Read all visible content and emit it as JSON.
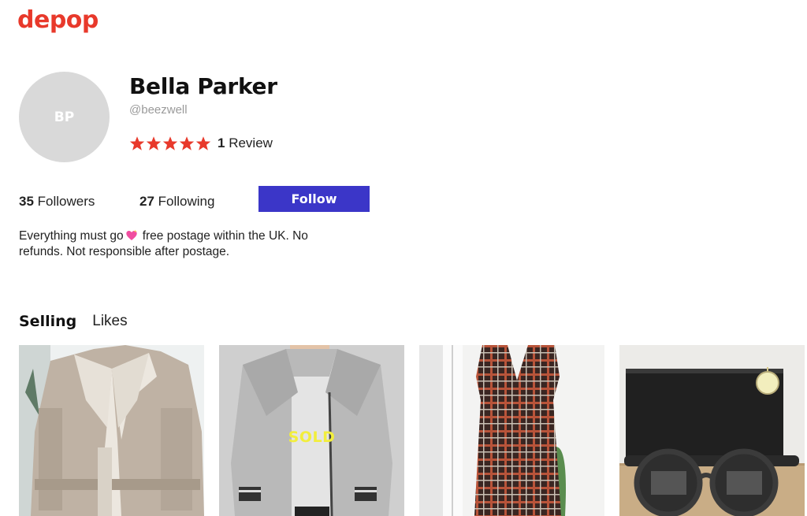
{
  "brand": {
    "logo_text": "depop",
    "color": "#e8392b"
  },
  "profile": {
    "initials": "BP",
    "name": "Bella Parker",
    "handle": "@beezwell",
    "rating_stars": 5,
    "review_count": "1",
    "review_label": "Review",
    "star_color": "#e8392b"
  },
  "stats": {
    "followers_count": "35",
    "followers_label": "Followers",
    "following_count": "27",
    "following_label": "Following"
  },
  "follow_button": {
    "label": "Follow",
    "color": "#3b36c8"
  },
  "bio": {
    "part1": "Everything must go",
    "part2": "free postage within the UK. No refunds. Not responsible after postage."
  },
  "tabs": {
    "selling": "Selling",
    "likes": "Likes"
  },
  "items": [
    {
      "name": "shearling-jacket",
      "status": ""
    },
    {
      "name": "fleece-jacket",
      "status": "SOLD"
    },
    {
      "name": "plaid-pinafore-dress",
      "status": ""
    },
    {
      "name": "black-pouch-and-sunglasses",
      "status": ""
    }
  ]
}
